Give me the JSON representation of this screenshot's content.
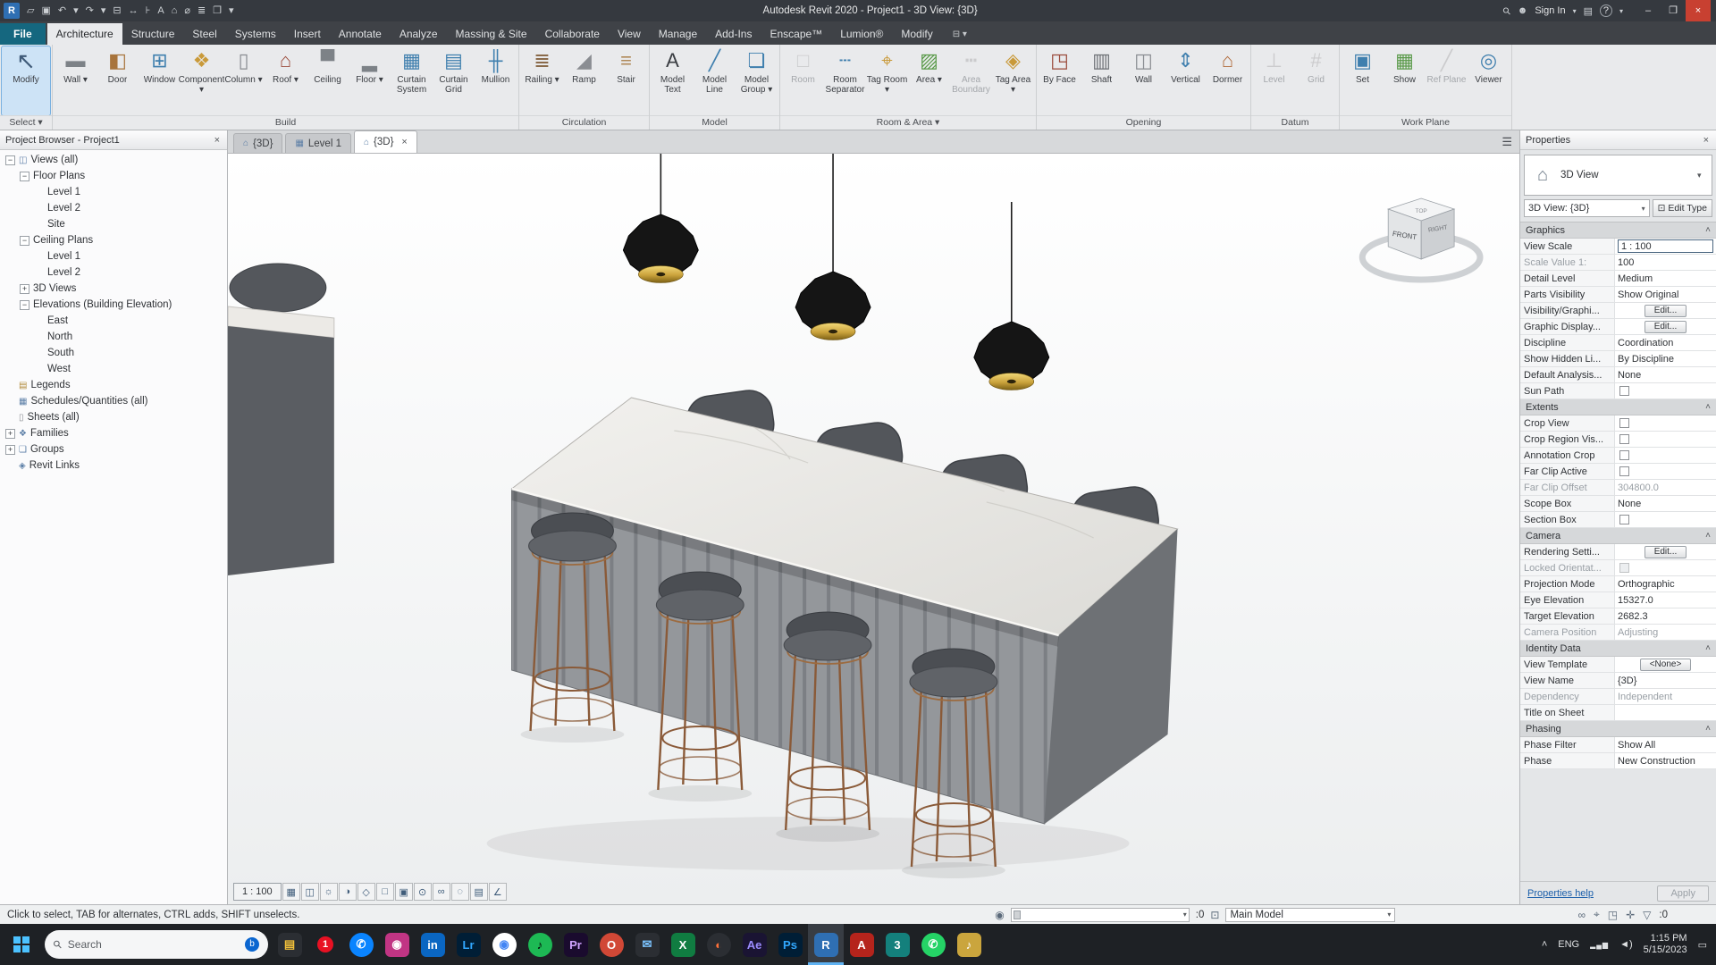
{
  "window": {
    "title": "Autodesk Revit 2020 - Project1 - 3D View: {3D}"
  },
  "title_bar": {
    "quick_access": [
      {
        "name": "app-menu",
        "glyph": "R"
      },
      {
        "name": "open-file",
        "glyph": "▱"
      },
      {
        "name": "save",
        "glyph": "▣"
      },
      {
        "name": "undo",
        "glyph": "↶"
      },
      {
        "name": "undo-dropdown",
        "glyph": "▾"
      },
      {
        "name": "redo",
        "glyph": "↷"
      },
      {
        "name": "redo-dropdown",
        "glyph": "▾"
      },
      {
        "name": "print",
        "glyph": "⊟"
      },
      {
        "name": "measure",
        "glyph": "↔"
      },
      {
        "name": "aligned-dimension",
        "glyph": "⊦"
      },
      {
        "name": "text-note",
        "glyph": "A"
      },
      {
        "name": "default-3d-view",
        "glyph": "⌂"
      },
      {
        "name": "section",
        "glyph": "⌀"
      },
      {
        "name": "thin-lines",
        "glyph": "≣"
      },
      {
        "name": "switch-windows",
        "glyph": "❐"
      },
      {
        "name": "customize-quick-access",
        "glyph": "▾"
      }
    ],
    "sign_in": "Sign In",
    "help_glyph": "?"
  },
  "ribbon": {
    "tabs": [
      {
        "label": "File",
        "type": "file"
      },
      {
        "label": "Architecture",
        "active": true
      },
      {
        "label": "Structure"
      },
      {
        "label": "Steel"
      },
      {
        "label": "Systems"
      },
      {
        "label": "Insert"
      },
      {
        "label": "Annotate"
      },
      {
        "label": "Analyze"
      },
      {
        "label": "Massing & Site"
      },
      {
        "label": "Collaborate"
      },
      {
        "label": "View"
      },
      {
        "label": "Manage"
      },
      {
        "label": "Add-Ins"
      },
      {
        "label": "Enscape™"
      },
      {
        "label": "Lumion®"
      },
      {
        "label": "Modify"
      }
    ],
    "panels": [
      {
        "label": "Select",
        "arrow": true,
        "buttons": [
          {
            "label": "Modify",
            "icon": "modify",
            "big": true,
            "selected": true
          }
        ]
      },
      {
        "label": "Build",
        "buttons": [
          {
            "label": "Wall",
            "icon": "wall",
            "arrow": true
          },
          {
            "label": "Door",
            "icon": "door"
          },
          {
            "label": "Window",
            "icon": "window"
          },
          {
            "label": "Component",
            "icon": "component",
            "arrow": true
          },
          {
            "label": "Column",
            "icon": "column",
            "arrow": true
          },
          {
            "label": "Roof",
            "icon": "roof",
            "arrow": true
          },
          {
            "label": "Ceiling",
            "icon": "ceiling"
          },
          {
            "label": "Floor",
            "icon": "floor",
            "arrow": true
          },
          {
            "label": "Curtain System",
            "icon": "curtain-system"
          },
          {
            "label": "Curtain Grid",
            "icon": "curtain-grid"
          },
          {
            "label": "Mullion",
            "icon": "mullion"
          }
        ]
      },
      {
        "label": "Circulation",
        "buttons": [
          {
            "label": "Railing",
            "icon": "railing",
            "arrow": true
          },
          {
            "label": "Ramp",
            "icon": "ramp"
          },
          {
            "label": "Stair",
            "icon": "stair"
          }
        ]
      },
      {
        "label": "Model",
        "buttons": [
          {
            "label": "Model Text",
            "icon": "model-text"
          },
          {
            "label": "Model Line",
            "icon": "model-line"
          },
          {
            "label": "Model Group",
            "icon": "model-group",
            "arrow": true
          }
        ]
      },
      {
        "label": "Room & Area",
        "arrow": true,
        "buttons": [
          {
            "label": "Room",
            "icon": "room",
            "disabled": true
          },
          {
            "label": "Room Separator",
            "icon": "room-separator"
          },
          {
            "label": "Tag Room",
            "icon": "tag-room",
            "arrow": true
          },
          {
            "label": "Area",
            "icon": "area",
            "arrow": true
          },
          {
            "label": "Area Boundary",
            "icon": "area-boundary",
            "disabled": true
          },
          {
            "label": "Tag Area",
            "icon": "tag-area",
            "arrow": true
          }
        ]
      },
      {
        "label": "Opening",
        "buttons": [
          {
            "label": "By Face",
            "icon": "by-face"
          },
          {
            "label": "Shaft",
            "icon": "shaft"
          },
          {
            "label": "Wall",
            "icon": "wall-opening"
          },
          {
            "label": "Vertical",
            "icon": "vertical-opening"
          },
          {
            "label": "Dormer",
            "icon": "dormer"
          }
        ]
      },
      {
        "label": "Datum",
        "buttons": [
          {
            "label": "Level",
            "icon": "level",
            "disabled": true
          },
          {
            "label": "Grid",
            "icon": "grid",
            "disabled": true
          }
        ]
      },
      {
        "label": "Work Plane",
        "buttons": [
          {
            "label": "Set",
            "icon": "set"
          },
          {
            "label": "Show",
            "icon": "show"
          },
          {
            "label": "Ref Plane",
            "icon": "ref-plane",
            "disabled": true
          },
          {
            "label": "Viewer",
            "icon": "viewer"
          }
        ]
      }
    ]
  },
  "project_browser": {
    "title": "Project Browser - Project1",
    "tree": [
      {
        "label": "Views (all)",
        "depth": 0,
        "expand": "minus",
        "icon": "views"
      },
      {
        "label": "Floor Plans",
        "depth": 1,
        "expand": "minus"
      },
      {
        "label": "Level 1",
        "depth": 2
      },
      {
        "label": "Level 2",
        "depth": 2
      },
      {
        "label": "Site",
        "depth": 2
      },
      {
        "label": "Ceiling Plans",
        "depth": 1,
        "expand": "minus"
      },
      {
        "label": "Level 1",
        "depth": 2
      },
      {
        "label": "Level 2",
        "depth": 2
      },
      {
        "label": "3D Views",
        "depth": 1,
        "expand": "plus"
      },
      {
        "label": "Elevations (Building Elevation)",
        "depth": 1,
        "expand": "minus"
      },
      {
        "label": "East",
        "depth": 2
      },
      {
        "label": "North",
        "depth": 2
      },
      {
        "label": "South",
        "depth": 2
      },
      {
        "label": "West",
        "depth": 2
      },
      {
        "label": "Legends",
        "depth": 0,
        "icon": "legends"
      },
      {
        "label": "Schedules/Quantities (all)",
        "depth": 0,
        "icon": "schedules"
      },
      {
        "label": "Sheets (all)",
        "depth": 0,
        "icon": "sheets"
      },
      {
        "label": "Families",
        "depth": 0,
        "expand": "plus",
        "icon": "families"
      },
      {
        "label": "Groups",
        "depth": 0,
        "expand": "plus",
        "icon": "groups"
      },
      {
        "label": "Revit Links",
        "depth": 0,
        "icon": "links"
      }
    ]
  },
  "view_tabs": [
    {
      "label": "{3D}",
      "icon": "⌂"
    },
    {
      "label": "Level 1",
      "icon": "▦"
    },
    {
      "label": "{3D}",
      "icon": "⌂",
      "active": true,
      "closable": true
    }
  ],
  "viewport": {
    "viewcube": {
      "front": "FRONT",
      "top": "TOP",
      "right": "RIGHT"
    },
    "view_controls": {
      "scale": "1 : 100",
      "icons": [
        {
          "name": "detail-level",
          "glyph": "▦"
        },
        {
          "name": "visual-style",
          "glyph": "◫"
        },
        {
          "name": "sun-path",
          "glyph": "☼"
        },
        {
          "name": "shadows",
          "glyph": "◑"
        },
        {
          "name": "rendering-dialog",
          "glyph": "◇"
        },
        {
          "name": "crop-view",
          "glyph": "□"
        },
        {
          "name": "show-crop-region",
          "glyph": "▣"
        },
        {
          "name": "unlocked-view",
          "glyph": "⊙"
        },
        {
          "name": "temporary-hide-isolate",
          "glyph": "∞"
        },
        {
          "name": "reveal-hidden-elements",
          "glyph": "◌"
        },
        {
          "name": "temporary-view-properties",
          "glyph": "▤"
        },
        {
          "name": "show-constraints",
          "glyph": "∠"
        }
      ]
    }
  },
  "properties": {
    "header": "Properties",
    "type_selector": {
      "label": "3D View"
    },
    "instance_selector": "3D View: {3D}",
    "edit_type": "Edit Type",
    "sections": [
      {
        "title": "Graphics",
        "rows": [
          {
            "label": "View Scale",
            "value": "1 : 100",
            "type": "input"
          },
          {
            "label": "Scale Value    1:",
            "value": "100",
            "type": "text",
            "disabled_label": true
          },
          {
            "label": "Detail Level",
            "value": "Medium",
            "type": "text"
          },
          {
            "label": "Parts Visibility",
            "value": "Show Original",
            "type": "text"
          },
          {
            "label": "Visibility/Graphi...",
            "value": "Edit...",
            "type": "button"
          },
          {
            "label": "Graphic Display...",
            "value": "Edit...",
            "type": "button"
          },
          {
            "label": "Discipline",
            "value": "Coordination",
            "type": "text"
          },
          {
            "label": "Show Hidden Li...",
            "value": "By Discipline",
            "type": "text"
          },
          {
            "label": "Default Analysis...",
            "value": "None",
            "type": "text"
          },
          {
            "label": "Sun Path",
            "type": "check"
          }
        ]
      },
      {
        "title": "Extents",
        "rows": [
          {
            "label": "Crop View",
            "type": "check"
          },
          {
            "label": "Crop Region Vis...",
            "type": "check"
          },
          {
            "label": "Annotation Crop",
            "type": "check"
          },
          {
            "label": "Far Clip Active",
            "type": "check"
          },
          {
            "label": "Far Clip Offset",
            "value": "304800.0",
            "type": "text",
            "disabled": true,
            "disabled_label": true
          },
          {
            "label": "Scope Box",
            "value": "None",
            "type": "text"
          },
          {
            "label": "Section Box",
            "type": "check"
          }
        ]
      },
      {
        "title": "Camera",
        "rows": [
          {
            "label": "Rendering Setti...",
            "value": "Edit...",
            "type": "button"
          },
          {
            "label": "Locked Orientat...",
            "type": "check",
            "disabled": true,
            "disabled_label": true
          },
          {
            "label": "Projection Mode",
            "value": "Orthographic",
            "type": "text"
          },
          {
            "label": "Eye Elevation",
            "value": "15327.0",
            "type": "text"
          },
          {
            "label": "Target Elevation",
            "value": "2682.3",
            "type": "text"
          },
          {
            "label": "Camera Position",
            "value": "Adjusting",
            "type": "text",
            "disabled": true,
            "disabled_label": true
          }
        ]
      },
      {
        "title": "Identity Data",
        "rows": [
          {
            "label": "View Template",
            "value": "<None>",
            "type": "button"
          },
          {
            "label": "View Name",
            "value": "{3D}",
            "type": "text"
          },
          {
            "label": "Dependency",
            "value": "Independent",
            "type": "text",
            "disabled": true,
            "disabled_label": true
          },
          {
            "label": "Title on Sheet",
            "value": "",
            "type": "text"
          }
        ]
      },
      {
        "title": "Phasing",
        "rows": [
          {
            "label": "Phase Filter",
            "value": "Show All",
            "type": "text"
          },
          {
            "label": "Phase",
            "value": "New Construction",
            "type": "text"
          }
        ]
      }
    ],
    "help_link": "Properties help",
    "apply": "Apply"
  },
  "status_bar": {
    "hint": "Click to select, TAB for alternates, CTRL adds, SHIFT unselects.",
    "editable_badge": ":0",
    "design_option": "Main Model",
    "filter_badge": ":0",
    "right_icons": [
      {
        "name": "select-links",
        "glyph": "∞"
      },
      {
        "name": "select-pinned-elements",
        "glyph": "⌖"
      },
      {
        "name": "select-elements-by-face",
        "glyph": "◳"
      },
      {
        "name": "drag-elements-on-selection",
        "glyph": "✛"
      },
      {
        "name": "filter",
        "glyph": "▽"
      }
    ]
  },
  "taskbar": {
    "search": "Search",
    "apps": [
      {
        "name": "file-explorer",
        "text": "▤",
        "bg": "#2b2e33",
        "fg": "#f3c13a"
      },
      {
        "name": "notification-badge-app",
        "text": "1",
        "bg": "#e81123",
        "fg": "#ffffff",
        "shape": "badge"
      },
      {
        "name": "messages",
        "text": "✆",
        "bg": "#0a84ff",
        "fg": "#ffffff",
        "shape": "round"
      },
      {
        "name": "instagram",
        "text": "◉",
        "bg": "#c13584",
        "fg": "#ffffff"
      },
      {
        "name": "linkedin",
        "text": "in",
        "bg": "#0a66c2",
        "fg": "#ffffff"
      },
      {
        "name": "lightroom",
        "text": "Lr",
        "bg": "#001e36",
        "fg": "#31a8ff"
      },
      {
        "name": "chrome",
        "text": "◉",
        "bg": "#ffffff",
        "fg": "#4285f4",
        "shape": "round"
      },
      {
        "name": "spotify",
        "text": "♪",
        "bg": "#1db954",
        "fg": "#000000",
        "shape": "round"
      },
      {
        "name": "premiere",
        "text": "Pr",
        "bg": "#1a0b2e",
        "fg": "#cfa3ff"
      },
      {
        "name": "opera",
        "text": "O",
        "bg": "#d14836",
        "fg": "#ffffff",
        "shape": "round"
      },
      {
        "name": "mail",
        "text": "✉",
        "bg": "#2b2e33",
        "fg": "#7cc4ff"
      },
      {
        "name": "excel",
        "text": "X",
        "bg": "#107c41",
        "fg": "#ffffff"
      },
      {
        "name": "firefox",
        "text": "◐",
        "bg": "#2b2e33",
        "fg": "#ff7139",
        "shape": "round"
      },
      {
        "name": "after-effects",
        "text": "Ae",
        "bg": "#1a1433",
        "fg": "#9b8cff"
      },
      {
        "name": "photoshop",
        "text": "Ps",
        "bg": "#001e36",
        "fg": "#31a8ff"
      },
      {
        "name": "revit",
        "text": "R",
        "bg": "#2f6fb3",
        "fg": "#ffffff",
        "active": true
      },
      {
        "name": "autocad",
        "text": "A",
        "bg": "#b5241c",
        "fg": "#ffffff"
      },
      {
        "name": "3ds-max",
        "text": "3",
        "bg": "#14807c",
        "fg": "#ffffff"
      },
      {
        "name": "whatsapp",
        "text": "✆",
        "bg": "#25d366",
        "fg": "#ffffff",
        "shape": "round"
      },
      {
        "name": "media-app",
        "text": "♪",
        "bg": "#caa53d",
        "fg": "#ffffff"
      }
    ],
    "tray": {
      "chevron": "˄",
      "lang": "ENG",
      "network": "▂▄▆",
      "volume": "◄)",
      "time": "1:15 PM",
      "date": "5/15/2023",
      "notifications": "▭"
    }
  }
}
